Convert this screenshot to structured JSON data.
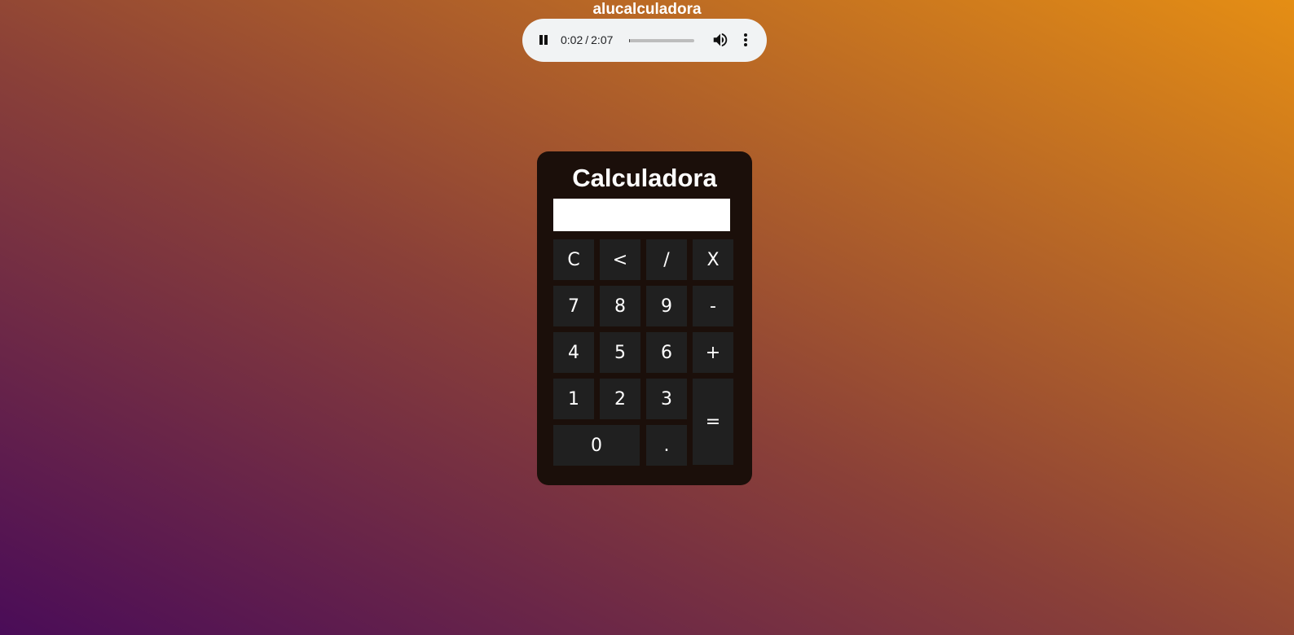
{
  "page": {
    "title": "alucalculadora"
  },
  "audio_player": {
    "current_time": "0:02",
    "separator": "/",
    "duration": "2:07",
    "progress_fraction": 0.016,
    "icons": [
      "pause-icon",
      "volume-icon",
      "more-options-icon"
    ]
  },
  "calculator": {
    "title": "Calculadora",
    "display_value": "",
    "keys": {
      "clear": "C",
      "backspace": "<",
      "divide": "/",
      "multiply": "X",
      "seven": "7",
      "eight": "8",
      "nine": "9",
      "minus": "-",
      "four": "4",
      "five": "5",
      "six": "6",
      "plus": "+",
      "one": "1",
      "two": "2",
      "three": "3",
      "equals": "=",
      "zero": "0",
      "decimal": "."
    }
  },
  "colors": {
    "gradient_start": "#4a0c58",
    "gradient_mid": "#8a4038",
    "gradient_end": "#e58e14",
    "calculator_bg": "#1b0f0a",
    "key_bg": "#202020",
    "player_bg": "#f1f3f4"
  }
}
